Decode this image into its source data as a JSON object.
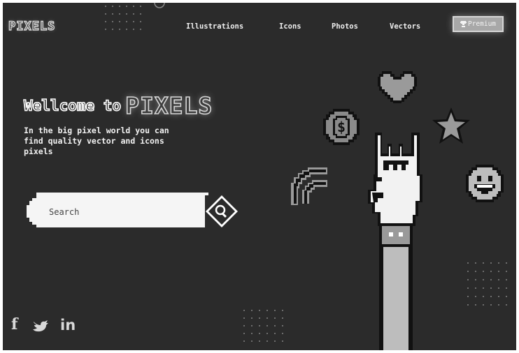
{
  "brand": {
    "logo": "PIXELS"
  },
  "nav": {
    "items": [
      "Illustrations",
      "Icons",
      "Photos",
      "Vectors"
    ],
    "premium_label": "Premium",
    "premium_icon": "trophy-icon"
  },
  "hero": {
    "title_lead": "Wellcome to",
    "title_brand": "PIXELS",
    "subtitle": "In the big pixel world you can\nfind quality vector and icons\npixels"
  },
  "search": {
    "placeholder": "Search",
    "button_icon": "search-icon"
  },
  "social": [
    {
      "icon": "facebook-icon",
      "glyph": "f"
    },
    {
      "icon": "twitter-icon",
      "glyph": ""
    },
    {
      "icon": "linkedin-icon",
      "glyph": "in"
    }
  ],
  "illustration": {
    "coin_symbol": "$",
    "icons": [
      "heart-icon",
      "coin-dollar-icon",
      "star-icon",
      "rainbow-icon",
      "smiley-icon",
      "rock-hand-illustration"
    ]
  },
  "colors": {
    "background": "#2b2b2b",
    "accent": "#a8a8a8",
    "text": "#f2f2f2"
  }
}
